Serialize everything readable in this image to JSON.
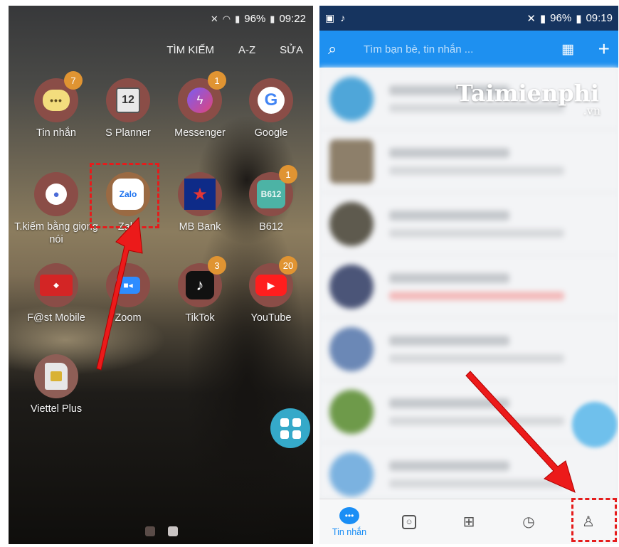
{
  "left_phone": {
    "status": {
      "battery": "96%",
      "time": "09:22"
    },
    "top_links": [
      "TÌM KIẾM",
      "A-Z",
      "SỬA"
    ],
    "apps": [
      {
        "label": "Tin nhắn",
        "icon": "messages-icon",
        "badge": "7"
      },
      {
        "label": "S Planner",
        "icon": "calendar-icon",
        "icon_text": "12",
        "badge": ""
      },
      {
        "label": "Messenger",
        "icon": "messenger-icon",
        "badge": "1"
      },
      {
        "label": "Google",
        "icon": "google-icon",
        "icon_text": "G",
        "badge": ""
      },
      {
        "label": "T.kiếm bằng giọng nói",
        "icon": "microphone-icon",
        "badge": ""
      },
      {
        "label": "Zalo",
        "icon": "zalo-icon",
        "icon_text": "Zalo",
        "badge": ""
      },
      {
        "label": "MB Bank",
        "icon": "mb-bank-icon",
        "badge": ""
      },
      {
        "label": "B612",
        "icon": "b612-icon",
        "icon_text": "B612",
        "badge": "1"
      },
      {
        "label": "F@st Mobile",
        "icon": "fast-mobile-icon",
        "badge": ""
      },
      {
        "label": "Zoom",
        "icon": "zoom-icon",
        "badge": ""
      },
      {
        "label": "TikTok",
        "icon": "tiktok-icon",
        "badge": "3"
      },
      {
        "label": "YouTube",
        "icon": "youtube-icon",
        "badge": "20"
      },
      {
        "label": "Viettel Plus",
        "icon": "sim-card-icon",
        "badge": ""
      }
    ]
  },
  "right_phone": {
    "status": {
      "battery": "96%",
      "time": "09:19"
    },
    "search": {
      "placeholder": "Tìm bạn bè, tin nhắn ..."
    },
    "watermark": {
      "main": "Taimienphi",
      "sub": ".vn"
    },
    "bottom_nav": [
      {
        "name": "messages",
        "label": "Tin nhắn",
        "icon": "chat-bubble-icon",
        "active": true
      },
      {
        "name": "contacts",
        "label": "",
        "icon": "contacts-icon",
        "active": false
      },
      {
        "name": "discover",
        "label": "",
        "icon": "grid-icon",
        "active": false
      },
      {
        "name": "timeline",
        "label": "",
        "icon": "clock-icon",
        "active": false
      },
      {
        "name": "profile",
        "label": "",
        "icon": "person-icon",
        "active": false
      }
    ]
  },
  "colors": {
    "highlight": "#e51c1c",
    "zalo_blue": "#1e90f0",
    "nav_active": "#1a8ef5",
    "badge": "#e09432"
  }
}
